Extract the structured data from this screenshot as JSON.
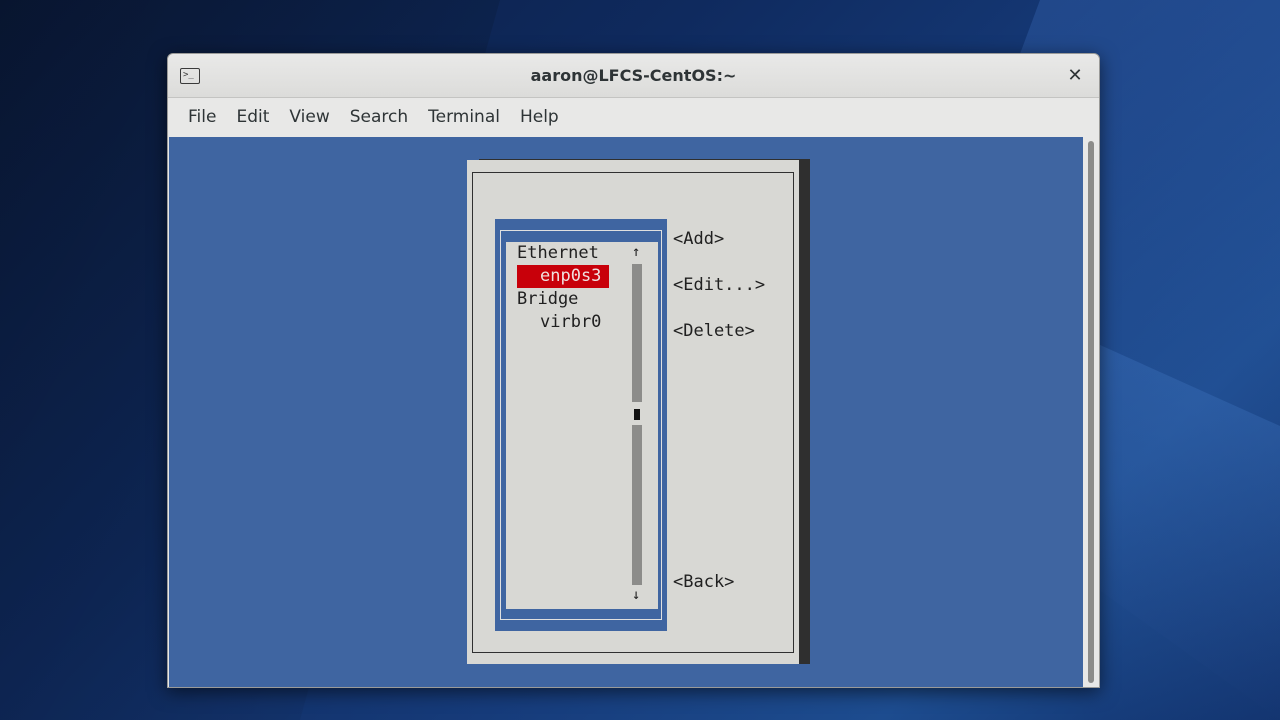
{
  "window": {
    "title": "aaron@LFCS-CentOS:~",
    "close_glyph": "✕",
    "icon": "terminal-icon"
  },
  "menu": [
    "File",
    "Edit",
    "View",
    "Search",
    "Terminal",
    "Help"
  ],
  "nmtui": {
    "list": [
      {
        "label": "Ethernet",
        "indent": false,
        "selected": false
      },
      {
        "label": "enp0s3",
        "indent": true,
        "selected": true
      },
      {
        "label": "Bridge",
        "indent": false,
        "selected": false
      },
      {
        "label": "virbr0",
        "indent": true,
        "selected": false
      }
    ],
    "scroll_up": "↑",
    "scroll_down": "↓",
    "buttons": {
      "add": "<Add>",
      "edit": "<Edit...>",
      "delete": "<Delete>",
      "back": "<Back>"
    }
  },
  "colors": {
    "terminal_bg": "#3f65a1",
    "dialog_bg": "#d8d8d4",
    "selection": "#c8000a"
  }
}
